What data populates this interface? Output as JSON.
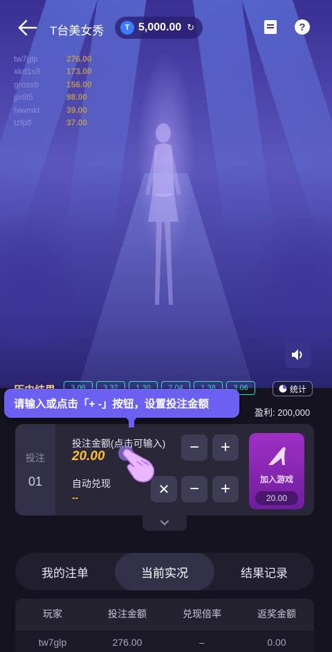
{
  "header": {
    "title": "T台美女秀",
    "balance": "5,000.00",
    "coin_glyph": "T"
  },
  "player_overlay": [
    {
      "name": "tw7glp",
      "amount": "276.00"
    },
    {
      "name": "xkd1s9",
      "amount": "173.00"
    },
    {
      "name": "grossb",
      "amount": "156.00"
    },
    {
      "name": "jjx6t5",
      "amount": "98.00"
    },
    {
      "name": "hiwmkt",
      "amount": "39.00"
    },
    {
      "name": "tzfpfl",
      "amount": "37.00"
    }
  ],
  "history": {
    "label": "历史结果",
    "items": [
      "3.06",
      "3.32",
      "1.30",
      "2.04",
      "1.38",
      "3.06"
    ],
    "stats_label": "统计"
  },
  "tooltip": "请输入或点击「+ -」按钮，设置投注金额",
  "profit": {
    "label": "盈利:",
    "value": "200,000"
  },
  "bet": {
    "slot_label": "投注",
    "slot_number": "01",
    "amount_label": "投注金额(点击可输入)",
    "amount_value": "20.00",
    "auto_label": "自动兑现",
    "auto_value": "--",
    "join_label": "加入游戏",
    "join_amount": "20.00"
  },
  "tabs": [
    {
      "label": "我的注单",
      "active": false
    },
    {
      "label": "当前实况",
      "active": true
    },
    {
      "label": "结果记录",
      "active": false
    }
  ],
  "table": {
    "headers": [
      "玩家",
      "投注金额",
      "兑现倍率",
      "返奖金额"
    ],
    "rows": [
      [
        "tw7glp",
        "276.00",
        "–",
        "0.00"
      ]
    ]
  },
  "colors": {
    "accent": "#6b60f2",
    "gold": "#ffbf33",
    "history_green": "#2ee6b8",
    "join_purple": "#a02fc6"
  }
}
